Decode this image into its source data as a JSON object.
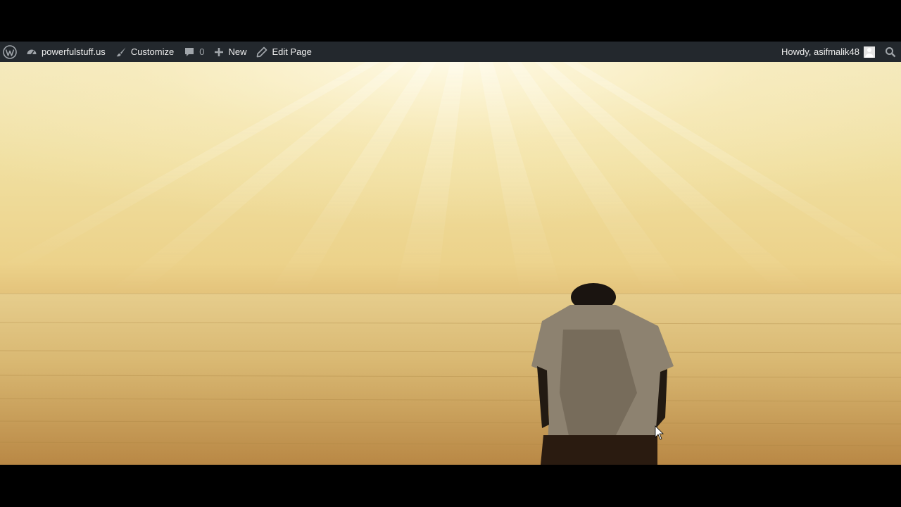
{
  "admin_bar": {
    "wp_logo": "wordpress-logo-icon",
    "site_name": "powerfulstuff.us",
    "customize_label": "Customize",
    "comments_count": "0",
    "new_label": "New",
    "edit_page_label": "Edit Page",
    "greeting": "Howdy, asifmalik48",
    "background_color": "#23282d",
    "text_color": "#eeeeee"
  },
  "hero": {
    "description_icon": "hero-image-icon"
  }
}
